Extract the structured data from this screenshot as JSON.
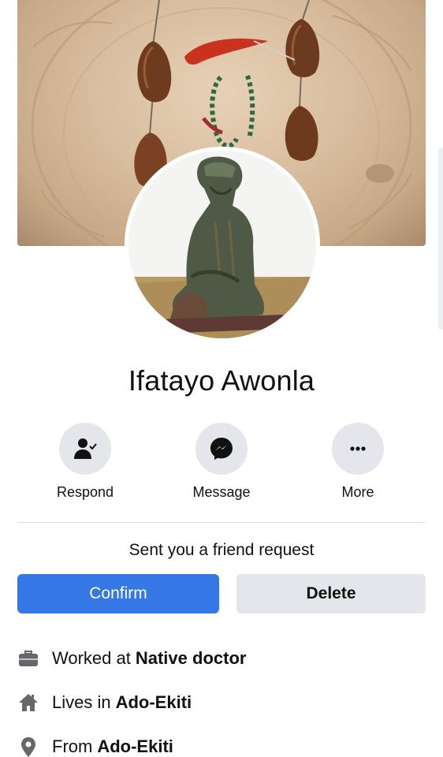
{
  "profile": {
    "name": "Ifatayo Awonla"
  },
  "actions": {
    "respond": {
      "label": "Respond",
      "icon": "person-check-icon"
    },
    "message": {
      "label": "Message",
      "icon": "messenger-icon"
    },
    "more": {
      "label": "More",
      "icon": "more-dots-icon"
    }
  },
  "request": {
    "text": "Sent you a friend request",
    "confirm_label": "Confirm",
    "delete_label": "Delete"
  },
  "about": {
    "work": {
      "prefix": "Worked at",
      "value": "Native doctor",
      "icon": "briefcase-icon"
    },
    "lives": {
      "prefix": "Lives in",
      "value": "Ado-Ekiti",
      "icon": "home-icon"
    },
    "from": {
      "prefix": "From",
      "value": "Ado-Ekiti",
      "icon": "location-pin-icon"
    }
  },
  "colors": {
    "confirm_bg": "#3578e5",
    "secondary_bg": "#e4e6eb",
    "icon_gray": "#65676b"
  }
}
